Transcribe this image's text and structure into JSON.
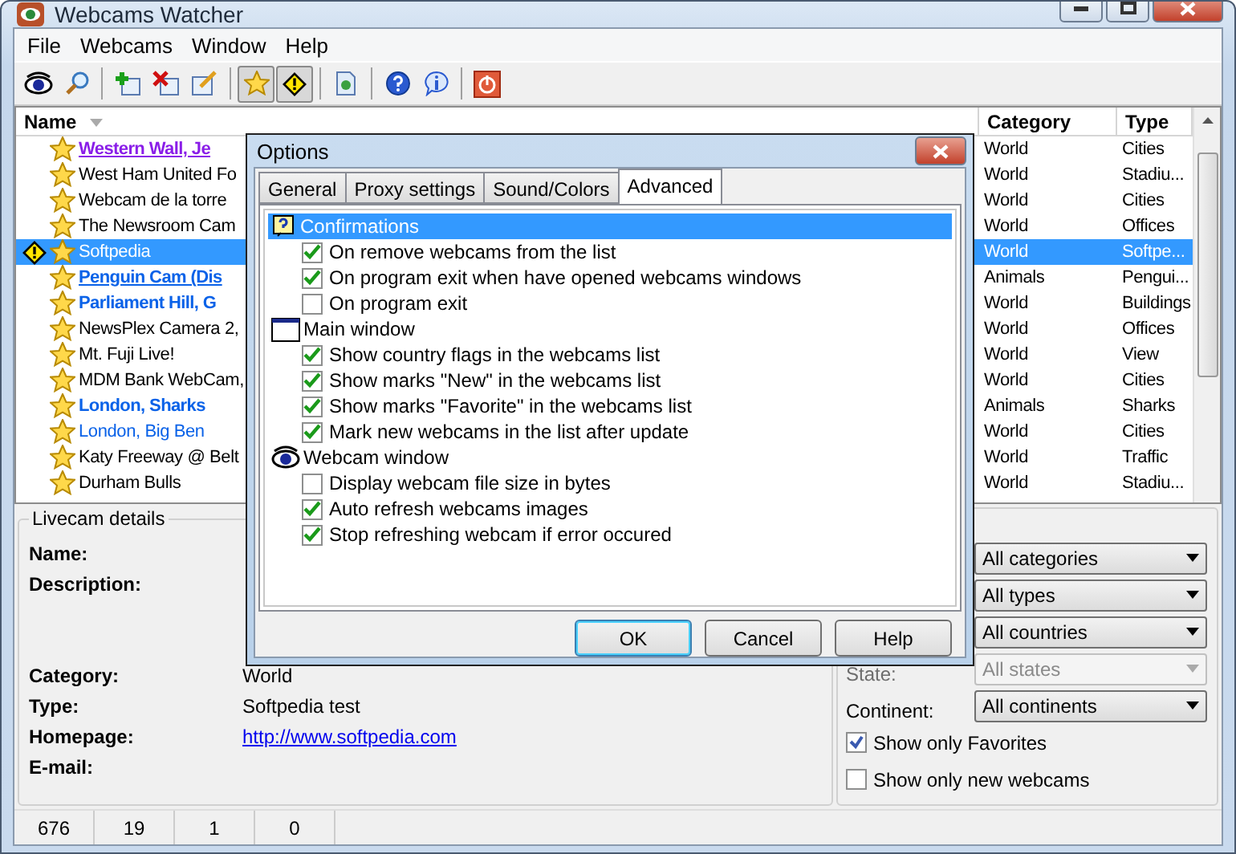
{
  "window": {
    "title": "Webcams Watcher"
  },
  "menu": [
    "File",
    "Webcams",
    "Window",
    "Help"
  ],
  "toolbar": [
    {
      "kind": "eye",
      "pressed": false
    },
    {
      "kind": "search",
      "pressed": false
    },
    {
      "kind": "sep"
    },
    {
      "kind": "add",
      "pressed": false
    },
    {
      "kind": "delete",
      "pressed": false
    },
    {
      "kind": "edit",
      "pressed": false
    },
    {
      "kind": "sep"
    },
    {
      "kind": "star",
      "pressed": true
    },
    {
      "kind": "warning",
      "pressed": true
    },
    {
      "kind": "sep"
    },
    {
      "kind": "refresh",
      "pressed": false
    },
    {
      "kind": "sep"
    },
    {
      "kind": "help",
      "pressed": false
    },
    {
      "kind": "info",
      "pressed": false
    },
    {
      "kind": "sep"
    },
    {
      "kind": "power",
      "pressed": false
    }
  ],
  "list": {
    "columns": [
      "Name",
      "Category",
      "Type"
    ],
    "rows": [
      {
        "name": "Western Wall, Je",
        "kind": "visited",
        "favorite": true,
        "new": false,
        "selected": false,
        "category": "World",
        "type": "Cities"
      },
      {
        "name": "West Ham United Fo",
        "kind": "plain",
        "favorite": true,
        "new": false,
        "selected": false,
        "category": "World",
        "type": "Stadiu..."
      },
      {
        "name": "Webcam de la torre",
        "kind": "plain",
        "favorite": true,
        "new": false,
        "selected": false,
        "category": "World",
        "type": "Cities"
      },
      {
        "name": "The Newsroom Cam",
        "kind": "plain",
        "favorite": true,
        "new": false,
        "selected": false,
        "category": "World",
        "type": "Offices"
      },
      {
        "name": "Softpedia",
        "kind": "plain",
        "favorite": true,
        "new": true,
        "selected": true,
        "category": "World",
        "type": "Softpe..."
      },
      {
        "name": "Penguin Cam (Dis",
        "kind": "link",
        "favorite": true,
        "new": false,
        "selected": false,
        "category": "Animals",
        "type": "Pengui..."
      },
      {
        "name": "Parliament Hill, G",
        "kind": "bold",
        "favorite": true,
        "new": false,
        "selected": false,
        "category": "World",
        "type": "Buildings"
      },
      {
        "name": "NewsPlex Camera 2,",
        "kind": "plain",
        "favorite": true,
        "new": false,
        "selected": false,
        "category": "World",
        "type": "Offices"
      },
      {
        "name": "Mt. Fuji Live!",
        "kind": "plain",
        "favorite": true,
        "new": false,
        "selected": false,
        "category": "World",
        "type": "View"
      },
      {
        "name": "MDM Bank WebCam,",
        "kind": "plain",
        "favorite": true,
        "new": false,
        "selected": false,
        "category": "World",
        "type": "Cities"
      },
      {
        "name": "London, Sharks",
        "kind": "bold",
        "favorite": true,
        "new": false,
        "selected": false,
        "category": "Animals",
        "type": "Sharks"
      },
      {
        "name": "London, Big Ben",
        "kind": "blue",
        "favorite": true,
        "new": false,
        "selected": false,
        "category": "World",
        "type": "Cities"
      },
      {
        "name": "Katy Freeway @ Belt",
        "kind": "plain",
        "favorite": true,
        "new": false,
        "selected": false,
        "category": "World",
        "type": "Traffic"
      },
      {
        "name": "Durham Bulls",
        "kind": "plain",
        "favorite": true,
        "new": false,
        "selected": false,
        "category": "World",
        "type": "Stadiu..."
      }
    ]
  },
  "details": {
    "title": "Livecam details",
    "fields": [
      {
        "label": "Name:"
      },
      {
        "label": "Description:",
        "kind": "tall"
      },
      {
        "label": "Category:",
        "value": "World"
      },
      {
        "label": "Type:",
        "value": "Softpedia test"
      },
      {
        "label": "Homepage:",
        "value": "http://www.softpedia.com",
        "kind": "link"
      },
      {
        "label": "E-mail:"
      }
    ]
  },
  "filters": {
    "dropdowns": [
      {
        "value": "All categories",
        "disabled": false
      },
      {
        "value": "All types",
        "disabled": false
      },
      {
        "value": "All countries",
        "disabled": false
      },
      {
        "label": "State:",
        "value": "All states",
        "disabled": true
      },
      {
        "label": "Continent:",
        "value": "All continents",
        "disabled": false
      }
    ],
    "checkboxes": [
      {
        "label": "Show only Favorites",
        "checked": true
      },
      {
        "label": "Show only new webcams",
        "checked": false
      }
    ]
  },
  "status_bar": [
    "676",
    "19",
    "1",
    "0"
  ],
  "dialog": {
    "title": "Options",
    "tabs": [
      {
        "label": "General",
        "selected": false
      },
      {
        "label": "Proxy settings",
        "selected": false
      },
      {
        "label": "Sound/Colors",
        "selected": false
      },
      {
        "label": "Advanced",
        "selected": true
      }
    ],
    "tree": [
      {
        "label": "Confirmations",
        "selected": true,
        "children": [
          {
            "label": "On remove webcams from the list",
            "checked": true
          },
          {
            "label": "On program exit when have opened webcams windows",
            "checked": true
          },
          {
            "label": "On program exit",
            "checked": false
          }
        ]
      },
      {
        "label": "Main window",
        "selected": false,
        "children": [
          {
            "label": "Show country flags in the webcams list",
            "checked": true
          },
          {
            "label": "Show marks \"New\" in the webcams list",
            "checked": true
          },
          {
            "label": "Show marks \"Favorite\" in the webcams list",
            "checked": true
          },
          {
            "label": "Mark new webcams in the list after update",
            "checked": true
          }
        ]
      },
      {
        "label": "Webcam window",
        "selected": false,
        "children": [
          {
            "label": "Display webcam file size in bytes",
            "checked": false
          },
          {
            "label": "Auto refresh webcams images",
            "checked": true
          },
          {
            "label": "Stop refreshing webcam if error occured",
            "checked": true
          }
        ]
      }
    ],
    "buttons": [
      {
        "label": "OK",
        "default": true
      },
      {
        "label": "Cancel",
        "default": false
      },
      {
        "label": "Help",
        "default": false
      }
    ]
  }
}
